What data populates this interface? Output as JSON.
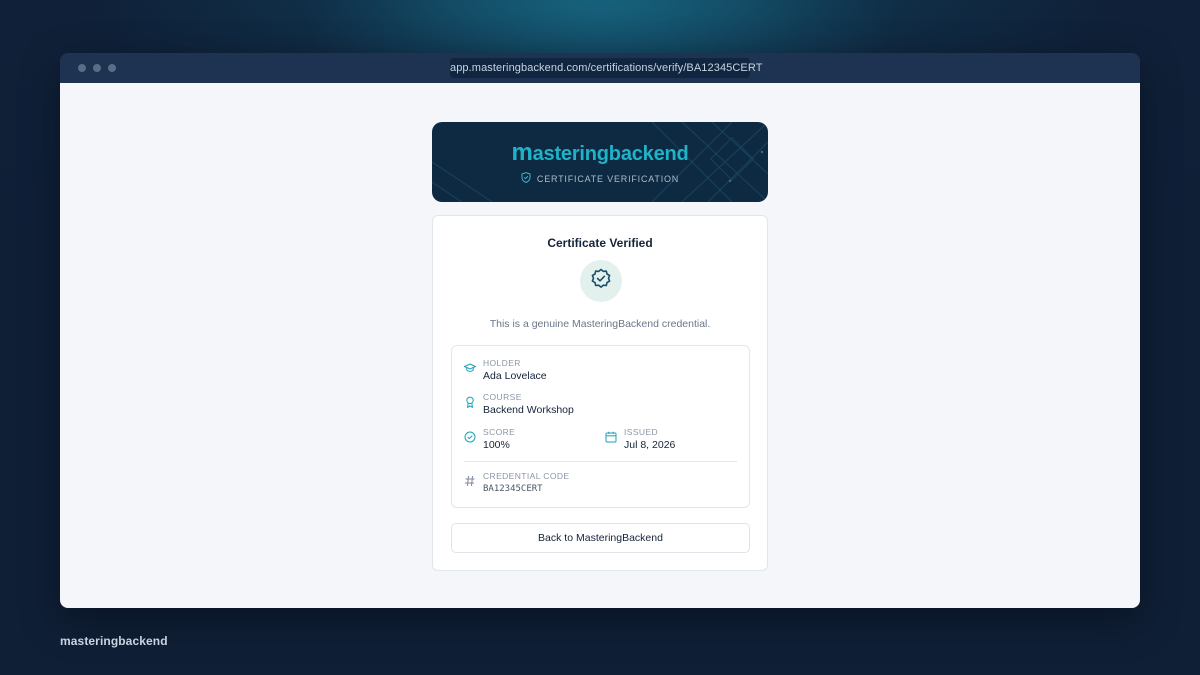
{
  "browser": {
    "url": "app.masteringbackend.com/certifications/verify/BA12345CERT"
  },
  "banner": {
    "brand_first_letter": "m",
    "brand_rest": "asteringbackend",
    "subtitle": "CERTIFICATE VERIFICATION",
    "subtitle_icon": "shield-check-icon"
  },
  "card": {
    "title": "Certificate Verified",
    "status_icon": "verified-badge-icon",
    "description": "This is a genuine MasteringBackend credential.",
    "fields": {
      "holder": {
        "label": "HOLDER",
        "value": "Ada Lovelace",
        "icon": "graduation-cap-icon"
      },
      "course": {
        "label": "COURSE",
        "value": "Backend Workshop",
        "icon": "award-ribbon-icon"
      },
      "score": {
        "label": "SCORE",
        "value": "100%",
        "icon": "check-circle-icon"
      },
      "issued": {
        "label": "ISSUED",
        "value": "Jul 8, 2026",
        "icon": "calendar-icon"
      },
      "credential_code": {
        "label": "CREDENTIAL CODE",
        "value": "BA12345CERT",
        "icon": "hash-icon"
      }
    },
    "back_button_label": "Back to MasteringBackend"
  },
  "footer": {
    "brand": "masteringbackend"
  },
  "colors": {
    "accent": "#1fb3c9",
    "banner_bg": "#0e2a42",
    "page_bg": "#0f1f36",
    "success_tint": "#e3f1ee"
  }
}
